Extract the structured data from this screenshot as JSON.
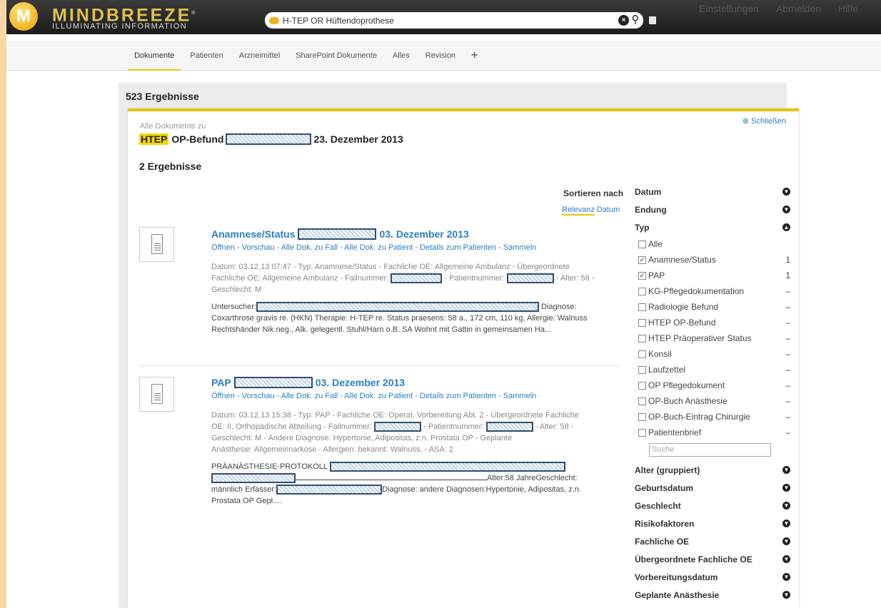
{
  "brand": {
    "name": "MINDBREEZE",
    "tagline": "ILLUMINATING INFORMATION",
    "accent": "#e8c300"
  },
  "search": {
    "query": "H-TEP OR Hüftendoprothese"
  },
  "top_links": [
    "Einstellungen",
    "Abmelden",
    "Hilfe"
  ],
  "tabs": [
    "Dokumente",
    "Patienten",
    "Arzneimittel",
    "SharePoint Dokumente",
    "Alles",
    "Revision",
    "+"
  ],
  "results_count": "523 Ergebnisse",
  "panel": {
    "close": "Schließen",
    "all_docs": "Alle Dokumente zu",
    "title_highlight": "HTEP",
    "title_a": "OP-Befund",
    "title_b": "23. Dezember 2013",
    "sub_count": "2 Ergebnisse",
    "sort_label": "Sortieren nach",
    "sort_options": [
      "Relevanz",
      "Datum"
    ]
  },
  "results": [
    {
      "title_a": "Anamnese/Status",
      "title_b": "03. Dezember 2013",
      "links": "Öffnen - Vorschau - Alle Dok. zu Fall - Alle Dok. zu Patient - Details zum Patienten - Sammeln",
      "meta_1": "Datum: 03.12.13 07:47 - Typ: Anamnese/Status - Fachliche OE: Allgemeine Ambulanz - Übergeordnete",
      "meta_2a": "Fachliche OE: Allgemeine Ambulanz - Fallnummer:",
      "meta_2b": "- Patientnummer:",
      "meta_2c": "- Alter: 58 -",
      "meta_3": "Geschlecht: M",
      "snip_1a": "Untersucher:",
      "snip_1b": "Diagnose:",
      "snip_2": "Coxarthrose gravis re. (HKN) Therapie: H-TEP re. Status praesens: 58 a., 172 cm, 110 kg, Allergie: Walnuss",
      "snip_3": "Rechtshänder Nik.neg., Alk. gelegentl. Stuhl/Harn o.B. SA Wohnt mit Gattin in gemeinsamen Ha..."
    },
    {
      "title_a": "PAP",
      "title_b": "03. Dezember 2013",
      "links": "Öffnen - Vorschau - Alle Dok. zu Fall - Alle Dok. zu Patient - Details zum Patienten - Sammeln",
      "meta_1": "Datum: 03.12.13 15:38 - Typ: PAP - Fachliche OE: Operat. Vorbereitung Abt. 2 - Übergeordnete Fachliche",
      "meta_2a": "OE: II. Orthopädische Abteilung - Fallnummer:",
      "meta_2b": "- Patientnummer:",
      "meta_2c": "- Alter: 58 -",
      "meta_3": "Geschlecht: M - Andere Diagnose: Hypertonie, Adipositas, z.n. Prostata OP - Geplante",
      "meta_4": "Anästhesie: Allgemeinnarkose - Allergien: bekannt: Walnuss, - ASA: 2",
      "snip_1": "PRÄANÄSTHESIE-PROTOKOLL",
      "snip_2": "Alter:58 JahreGeschlecht:",
      "snip_3a": "männlich Erfasser:",
      "snip_3b": "Diagnose: andere Diagnosen:Hypertonie, Adipositas, z.n.",
      "snip_4": "Prostata OP Gepl...."
    }
  ],
  "facets": {
    "top": [
      "Datum",
      "Endung",
      "Typ"
    ],
    "typ_items": [
      {
        "label": "Alle",
        "checked": false,
        "count": ""
      },
      {
        "label": "Anamnese/Status",
        "checked": true,
        "count": "1"
      },
      {
        "label": "PAP",
        "checked": true,
        "count": "1"
      },
      {
        "label": "KG-Pflegedokumentation",
        "checked": false,
        "count": "–"
      },
      {
        "label": "Radiologie Befund",
        "checked": false,
        "count": "–"
      },
      {
        "label": "HTEP OP-Befund",
        "checked": false,
        "count": "–"
      },
      {
        "label": "HTEP Präoperativer Status",
        "checked": false,
        "count": "–"
      },
      {
        "label": "Konsil",
        "checked": false,
        "count": "–"
      },
      {
        "label": "Laufzettel",
        "checked": false,
        "count": "–"
      },
      {
        "label": "OP Pflegedokument",
        "checked": false,
        "count": "–"
      },
      {
        "label": "OP-Buch Anästhesie",
        "checked": false,
        "count": "–"
      },
      {
        "label": "OP-Buch-Eintrag Chirurgie",
        "checked": false,
        "count": "–"
      },
      {
        "label": "Patientenbrief",
        "checked": false,
        "count": "–"
      }
    ],
    "search_placeholder": "Suche",
    "bottom": [
      "Alter (gruppiert)",
      "Geburtsdatum",
      "Geschlecht",
      "Risikofaktoren",
      "Fachliche OE",
      "Übergeordnete Fachliche OE",
      "Vorbereitungsdatum",
      "Geplante Anästhesie"
    ]
  }
}
